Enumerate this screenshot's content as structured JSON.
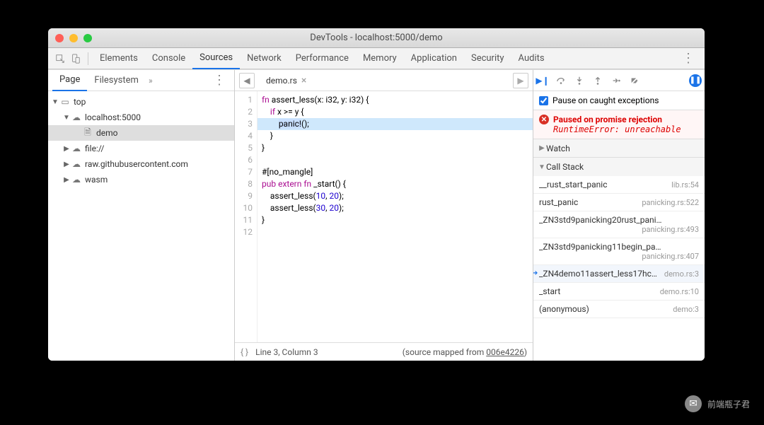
{
  "window": {
    "title": "DevTools - localhost:5000/demo"
  },
  "tabs": {
    "items": [
      "Elements",
      "Console",
      "Sources",
      "Network",
      "Performance",
      "Memory",
      "Application",
      "Security",
      "Audits"
    ],
    "active": 2
  },
  "left": {
    "tabs": [
      "Page",
      "Filesystem"
    ],
    "active": 0,
    "tree": [
      {
        "label": "top",
        "depth": 0,
        "expanded": true,
        "icon": "frame"
      },
      {
        "label": "localhost:5000",
        "depth": 1,
        "expanded": true,
        "icon": "cloud"
      },
      {
        "label": "demo",
        "depth": 2,
        "selected": true,
        "icon": "file"
      },
      {
        "label": "file://",
        "depth": 1,
        "expanded": false,
        "icon": "cloud"
      },
      {
        "label": "raw.githubusercontent.com",
        "depth": 1,
        "expanded": false,
        "icon": "cloud"
      },
      {
        "label": "wasm",
        "depth": 1,
        "expanded": false,
        "icon": "cloud"
      }
    ]
  },
  "editor": {
    "filename": "demo.rs",
    "lines": [
      "fn assert_less(x: i32, y: i32) {",
      "    if x >= y {",
      "        panic!();",
      "    }",
      "}",
      "",
      "#[no_mangle]",
      "pub extern fn _start() {",
      "    assert_less(10, 20);",
      "    assert_less(30, 20);",
      "}",
      ""
    ],
    "highlight_line": 3,
    "cursor": "Line 3, Column 3",
    "sourcemap_prefix": "(source mapped from ",
    "sourcemap_hash": "006e4226",
    "sourcemap_suffix": ")"
  },
  "right": {
    "pause_checkbox_label": "Pause on caught exceptions",
    "error_title": "Paused on promise rejection",
    "error_msg": "RuntimeError: unreachable",
    "panes": {
      "watch": "Watch",
      "callstack": "Call Stack"
    },
    "stack": [
      {
        "name": "__rust_start_panic",
        "loc": "lib.rs:54"
      },
      {
        "name": "rust_panic",
        "loc": "panicking.rs:522"
      },
      {
        "name": "_ZN3std9panicking20rust_pani…",
        "loc": "panicking.rs:493"
      },
      {
        "name": "_ZN3std9panicking11begin_pa…",
        "loc": "panicking.rs:407"
      },
      {
        "name": "_ZN4demo11assert_less17hc8…",
        "loc": "demo.rs:3",
        "current": true
      },
      {
        "name": "_start",
        "loc": "demo.rs:10"
      },
      {
        "name": "(anonymous)",
        "loc": "demo:3"
      }
    ]
  },
  "watermark": "前端瓶子君"
}
